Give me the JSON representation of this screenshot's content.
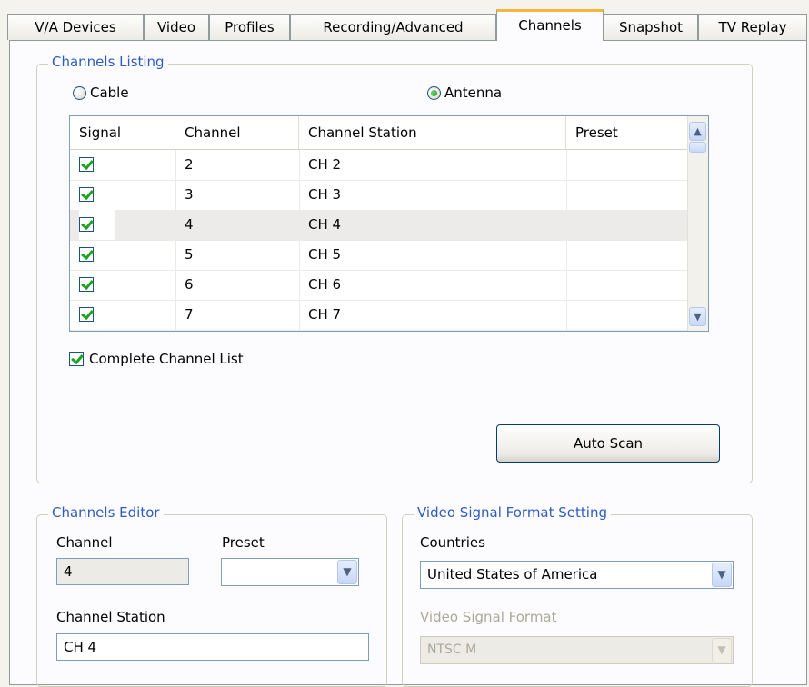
{
  "tabs": [
    "V/A Devices",
    "Video",
    "Profiles",
    "Recording/Advanced",
    "Channels",
    "Snapshot",
    "TV Replay"
  ],
  "channels_listing": {
    "legend": "Channels Listing",
    "cable_label": "Cable",
    "antenna_label": "Antenna",
    "selected_source": "Antenna",
    "columns": [
      "Signal",
      "Channel",
      "Channel Station",
      "Preset"
    ],
    "rows": [
      {
        "signal": true,
        "channel": "2",
        "station": "CH 2",
        "preset": ""
      },
      {
        "signal": true,
        "channel": "3",
        "station": "CH 3",
        "preset": ""
      },
      {
        "signal": true,
        "channel": "4",
        "station": "CH 4",
        "preset": ""
      },
      {
        "signal": true,
        "channel": "5",
        "station": "CH 5",
        "preset": ""
      },
      {
        "signal": true,
        "channel": "6",
        "station": "CH 6",
        "preset": ""
      },
      {
        "signal": true,
        "channel": "7",
        "station": "CH 7",
        "preset": ""
      }
    ],
    "complete_list_label": "Complete Channel List",
    "complete_list_checked": true,
    "auto_scan_label": "Auto Scan"
  },
  "channels_editor": {
    "legend": "Channels Editor",
    "channel_label": "Channel",
    "channel_value": "4",
    "preset_label": "Preset",
    "preset_value": "",
    "station_label": "Channel Station",
    "station_value": "CH 4"
  },
  "video_signal": {
    "legend": "Video Signal Format Setting",
    "countries_label": "Countries",
    "countries_value": "United States of America",
    "format_label": "Video Signal Format",
    "format_value": "NTSC M"
  },
  "icons": {
    "scroll_up": "▲",
    "scroll_down": "▼",
    "dropdown_arrow": "▼"
  },
  "colors": {
    "group_legend": "#2e5bbf",
    "active_tab_accent": "#f7b540",
    "checkbox_check": "#21a121"
  }
}
